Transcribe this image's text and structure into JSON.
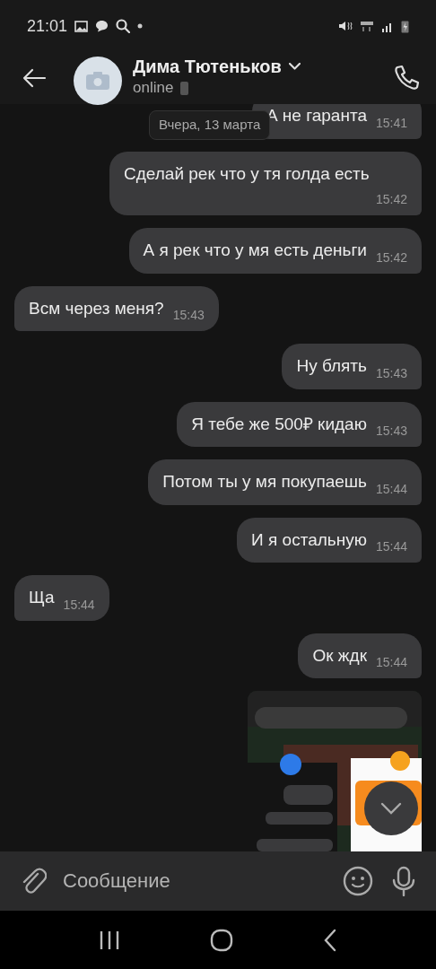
{
  "status_bar": {
    "time": "21:01"
  },
  "header": {
    "name": "Дима Тютеньков",
    "presence": "online"
  },
  "date_pill": "Вчера, 13 марта",
  "messages": [
    {
      "text": "А не гаранта",
      "time": "15:41",
      "outgoing": true
    },
    {
      "text": "Сделай рек что у тя голда есть",
      "time": "15:42",
      "outgoing": true
    },
    {
      "text": "А я рек что у мя есть деньги",
      "time": "15:42",
      "outgoing": true
    },
    {
      "text": "Всм через меня?",
      "time": "15:43",
      "outgoing": false
    },
    {
      "text": "Ну блять",
      "time": "15:43",
      "outgoing": true
    },
    {
      "text": "Я тебе же 500₽ кидаю",
      "time": "15:43",
      "outgoing": true
    },
    {
      "text": "Потом ты у мя покупаешь",
      "time": "15:44",
      "outgoing": true
    },
    {
      "text": "И я остальную",
      "time": "15:44",
      "outgoing": true
    },
    {
      "text": "Ща",
      "time": "15:44",
      "outgoing": false
    },
    {
      "text": "Ок ждк",
      "time": "15:44",
      "outgoing": true
    },
    {
      "kind": "picture",
      "outgoing": true
    }
  ],
  "composer": {
    "placeholder": "Сообщение"
  }
}
